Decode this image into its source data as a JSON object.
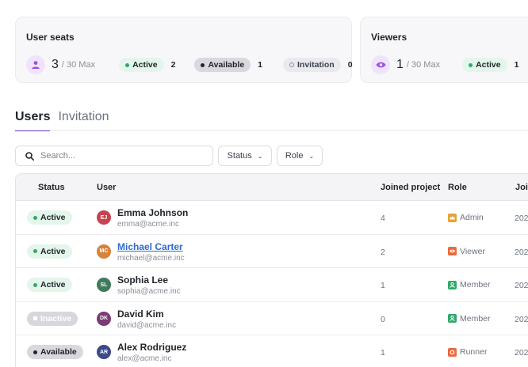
{
  "seats_card": {
    "title": "User seats",
    "count": "3",
    "max": "/ 30 Max",
    "active_label": "Active",
    "active_count": "2",
    "available_label": "Available",
    "available_count": "1",
    "invitation_label": "Invitation",
    "invitation_count": "0",
    "icon": "user-icon"
  },
  "viewers_card": {
    "title": "Viewers",
    "count": "1",
    "max": "/ 30 Max",
    "active_label": "Active",
    "active_count": "1",
    "icon": "eye-icon"
  },
  "tabs": [
    {
      "label": "Users",
      "active": true
    },
    {
      "label": "Invitation",
      "active": false
    }
  ],
  "toolbar": {
    "search_placeholder": "Search...",
    "status_filter": "Status",
    "role_filter": "Role"
  },
  "table": {
    "headers": {
      "status": "Status",
      "user": "User",
      "joined": "Joined project",
      "role": "Role",
      "join_date": "Joi"
    },
    "rows": [
      {
        "status": "Active",
        "initials": "EJ",
        "avatar_color": "#c8424f",
        "name": "Emma Johnson",
        "email": "emma@acme.inc",
        "joined": "4",
        "role": "Admin",
        "role_color": "#e7a233",
        "date": "202"
      },
      {
        "status": "Active",
        "initials": "MC",
        "avatar_color": "#d9823b",
        "name": "Michael Carter",
        "email": "michael@acme.inc",
        "joined": "2",
        "role": "Viewer",
        "role_color": "#ec6a3c",
        "date": "202"
      },
      {
        "status": "Active",
        "initials": "SL",
        "avatar_color": "#3f7a5b",
        "name": "Sophia Lee",
        "email": "sophia@acme.inc",
        "joined": "1",
        "role": "Member",
        "role_color": "#2fa86a",
        "date": "202"
      },
      {
        "status": "Inactive",
        "initials": "DK",
        "avatar_color": "#7b3b75",
        "name": "David Kim",
        "email": "david@acme.inc",
        "joined": "0",
        "role": "Member",
        "role_color": "#2fa86a",
        "date": "202"
      },
      {
        "status": "Available",
        "initials": "AR",
        "avatar_color": "#3a4a8a",
        "name": "Alex Rodriguez",
        "email": "alex@acme.inc",
        "joined": "1",
        "role": "Runner",
        "role_color": "#ec6a3c",
        "date": "202"
      }
    ]
  },
  "colors": {
    "accent": "#7b3fe4",
    "active_green": "#2fa86a",
    "link": "#2f6ad0"
  }
}
